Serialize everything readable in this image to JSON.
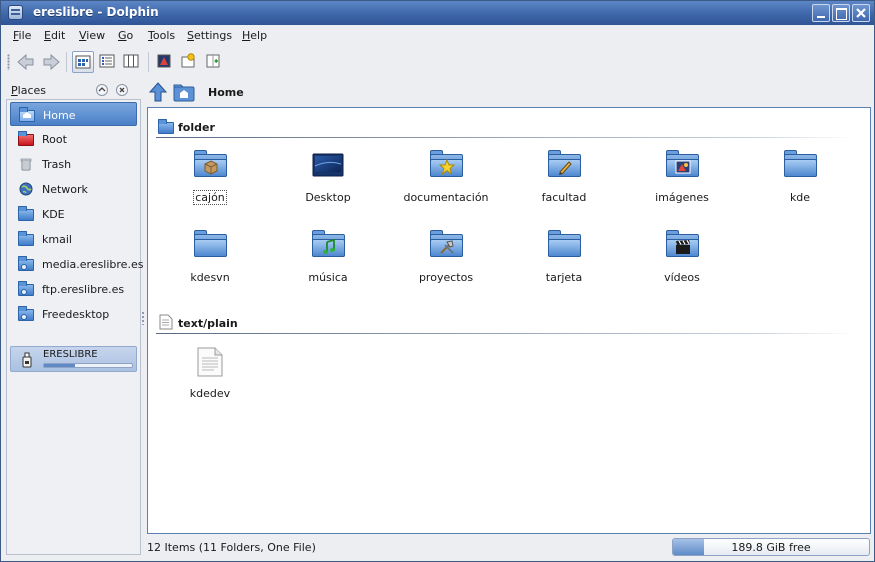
{
  "window": {
    "title": "ereslibre - Dolphin"
  },
  "menubar": {
    "items": [
      {
        "label": "File",
        "mnemonic": "F",
        "rest": "ile"
      },
      {
        "label": "Edit",
        "mnemonic": "E",
        "rest": "dit"
      },
      {
        "label": "View",
        "mnemonic": "V",
        "rest": "iew"
      },
      {
        "label": "Go",
        "mnemonic": "G",
        "rest": "o"
      },
      {
        "label": "Tools",
        "mnemonic": "T",
        "rest": "ools"
      },
      {
        "label": "Settings",
        "mnemonic": "S",
        "rest": "ettings"
      },
      {
        "label": "Help",
        "mnemonic": "H",
        "rest": "elp"
      }
    ]
  },
  "toolbar": {
    "buttons": [
      "back-icon",
      "forward-icon",
      "icons-view-icon",
      "details-view-icon",
      "columns-view-icon",
      "preview-icon",
      "new-folder-icon",
      "split-view-icon"
    ],
    "active_view": "icons"
  },
  "places": {
    "title": "Places",
    "title_mnemonic": "P",
    "title_rest": "laces",
    "items": [
      {
        "label": "Home",
        "icon": "home-folder-icon",
        "selected": true
      },
      {
        "label": "Root",
        "icon": "root-folder-icon"
      },
      {
        "label": "Trash",
        "icon": "trash-icon"
      },
      {
        "label": "Network",
        "icon": "network-icon"
      },
      {
        "label": "KDE",
        "icon": "folder-icon"
      },
      {
        "label": "kmail",
        "icon": "folder-icon"
      },
      {
        "label": "media.ereslibre.es",
        "icon": "remote-folder-icon"
      },
      {
        "label": "ftp.ereslibre.es",
        "icon": "remote-folder-icon"
      },
      {
        "label": "Freedesktop",
        "icon": "remote-folder-icon"
      }
    ],
    "drive": {
      "label": "ERESLIBRE",
      "icon": "usb-drive-icon",
      "usage": 0.35
    }
  },
  "location": {
    "current": "Home"
  },
  "groups": [
    {
      "label": "folder",
      "items": [
        {
          "label": "cajón",
          "emblem": "box",
          "focused": true
        },
        {
          "label": "Desktop",
          "emblem": "desktop"
        },
        {
          "label": "documentación",
          "emblem": "star"
        },
        {
          "label": "facultad",
          "emblem": "pencil"
        },
        {
          "label": "imágenes",
          "emblem": "image"
        },
        {
          "label": "kde",
          "emblem": "none"
        },
        {
          "label": "kdesvn",
          "emblem": "none"
        },
        {
          "label": "música",
          "emblem": "music"
        },
        {
          "label": "proyectos",
          "emblem": "tools"
        },
        {
          "label": "tarjeta",
          "emblem": "none"
        },
        {
          "label": "vídeos",
          "emblem": "video"
        }
      ]
    },
    {
      "label": "text/plain",
      "items": [
        {
          "label": "kdedev",
          "emblem": "text-file"
        }
      ]
    }
  ],
  "statusbar": {
    "text": "12 Items (11 Folders, One File)",
    "free_space": "189.8 GiB free",
    "used_fraction": 0.16
  },
  "colors": {
    "titlebar": "#3e67aa",
    "selection": "#4a80c8",
    "folder": "#3f78c3"
  }
}
